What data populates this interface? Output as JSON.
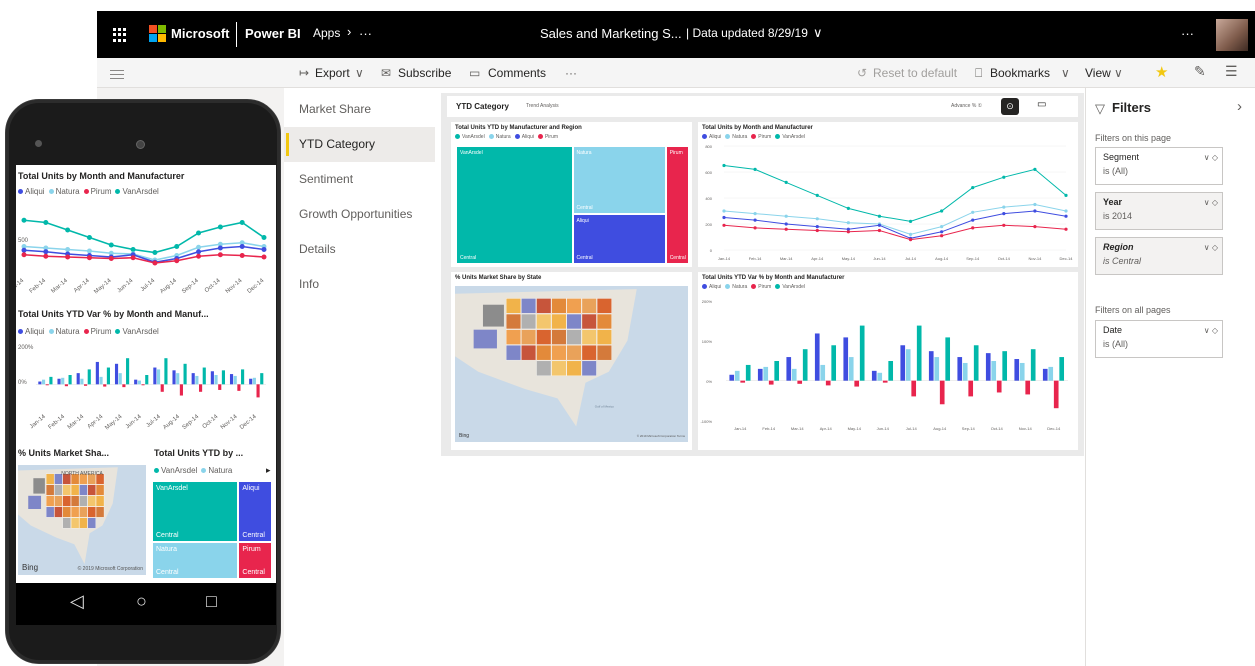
{
  "topbar": {
    "brand": "Microsoft",
    "product": "Power BI",
    "apps": "Apps",
    "more": "···",
    "report": "Sales and Marketing S...",
    "data_updated": "| Data updated 8/29/19",
    "chevron": "∨",
    "ellipsis": "···"
  },
  "commands": {
    "export": "Export",
    "subscribe": "Subscribe",
    "comments": "Comments",
    "more": "···",
    "reset": "Reset to default",
    "bookmarks": "Bookmarks",
    "view": "View"
  },
  "pages": [
    {
      "label": "Market Share",
      "active": false
    },
    {
      "label": "YTD Category",
      "active": true
    },
    {
      "label": "Sentiment",
      "active": false
    },
    {
      "label": "Growth Opportunities",
      "active": false
    },
    {
      "label": "Details",
      "active": false
    },
    {
      "label": "Info",
      "active": false
    }
  ],
  "canvas": {
    "title": "YTD Category",
    "subtitle": "Trend Analysis",
    "toggle": "Advance % ①"
  },
  "months": [
    "Jan-14",
    "Feb-14",
    "Mar-14",
    "Apr-14",
    "May-14",
    "Jun-14",
    "Jul-14",
    "Aug-14",
    "Sep-14",
    "Oct-14",
    "Nov-14",
    "Dec-14"
  ],
  "colors": {
    "VanArsdel": "#01b8aa",
    "Natura": "#8ad4eb",
    "Aliqui": "#3f4de0",
    "Pirum": "#e8254d",
    "accent": "#f2c811"
  },
  "treemap": {
    "title": "Total Units YTD by Manufacturer and Region",
    "legend": [
      "VanArsdel",
      "Natura",
      "Aliqui",
      "Pirum"
    ],
    "cells": [
      {
        "name": "VanArsdel",
        "sub": "Central",
        "color": "#01b8aa"
      },
      {
        "name": "Natura",
        "sub": "Central",
        "color": "#8ad4eb"
      },
      {
        "name": "Aliqui",
        "sub": "Central",
        "color": "#3f4de0"
      },
      {
        "name": "Pirum",
        "sub": "Central",
        "color": "#e8254d"
      }
    ]
  },
  "line_desktop": {
    "title": "Total Units by Month and Manufacturer",
    "legend": [
      "Aliqui",
      "Natura",
      "Pirum",
      "VanArsdel"
    ],
    "ymax": 800,
    "yticks": [
      "800",
      "600",
      "400",
      "200",
      "0"
    ]
  },
  "map": {
    "title": "% Units Market Share by State",
    "bing": "Bing",
    "credit": "© 2019 Microsoft Corporation Terms",
    "gulf": "Gulf of Mexico"
  },
  "bar_desktop": {
    "title": "Total Units YTD Var % by Month and Manufacturer",
    "legend": [
      "Aliqui",
      "Natura",
      "Pirum",
      "VanArsdel"
    ],
    "yticks": [
      "200%",
      "100%",
      "0%",
      "-100%"
    ]
  },
  "chart_data": [
    {
      "type": "line",
      "title": "Total Units by Month and Manufacturer",
      "categories": [
        "Jan-14",
        "Feb-14",
        "Mar-14",
        "Apr-14",
        "May-14",
        "Jun-14",
        "Jul-14",
        "Aug-14",
        "Sep-14",
        "Oct-14",
        "Nov-14",
        "Dec-14"
      ],
      "series": [
        {
          "name": "VanArsdel",
          "values": [
            650,
            620,
            520,
            420,
            320,
            260,
            220,
            300,
            480,
            560,
            620,
            420
          ]
        },
        {
          "name": "Natura",
          "values": [
            300,
            280,
            260,
            240,
            210,
            200,
            120,
            180,
            290,
            330,
            350,
            300
          ]
        },
        {
          "name": "Aliqui",
          "values": [
            250,
            230,
            200,
            180,
            160,
            190,
            90,
            140,
            230,
            280,
            300,
            260
          ]
        },
        {
          "name": "Pirum",
          "values": [
            190,
            170,
            160,
            150,
            140,
            150,
            80,
            110,
            170,
            190,
            180,
            160
          ]
        }
      ],
      "ylim": [
        0,
        800
      ]
    },
    {
      "type": "bar",
      "title": "Total Units YTD Var % by Month and Manufacturer",
      "categories": [
        "Jan-14",
        "Feb-14",
        "Mar-14",
        "Apr-14",
        "May-14",
        "Jun-14",
        "Jul-14",
        "Aug-14",
        "Sep-14",
        "Oct-14",
        "Nov-14",
        "Dec-14"
      ],
      "series": [
        {
          "name": "Aliqui",
          "values": [
            15,
            30,
            60,
            120,
            110,
            25,
            90,
            75,
            60,
            70,
            55,
            30
          ]
        },
        {
          "name": "Natura",
          "values": [
            25,
            35,
            30,
            40,
            60,
            20,
            80,
            60,
            45,
            50,
            45,
            35
          ]
        },
        {
          "name": "Pirum",
          "values": [
            -5,
            -10,
            -8,
            -12,
            -15,
            -5,
            -40,
            -60,
            -40,
            -30,
            -35,
            -70
          ]
        },
        {
          "name": "VanArsdel",
          "values": [
            40,
            50,
            80,
            90,
            140,
            50,
            140,
            110,
            90,
            75,
            80,
            60
          ]
        }
      ],
      "ylim": [
        -100,
        200
      ]
    }
  ],
  "filters": {
    "title": "Filters",
    "on_this_page": "Filters on this page",
    "on_all_pages": "Filters on all pages",
    "cards": [
      {
        "name": "Segment",
        "value": "is (All)"
      },
      {
        "name": "Year",
        "value": "is 2014"
      },
      {
        "name": "Region",
        "value": "is Central"
      },
      {
        "name": "Date",
        "value": "is (All)"
      }
    ]
  },
  "phone": {
    "line_title": "Total Units by Month and Manufacturer",
    "line_legend": [
      "Aliqui",
      "Natura",
      "Pirum",
      "VanArsdel"
    ],
    "line_y": "500",
    "bar_title": "Total Units YTD Var % by Month and Manuf...",
    "bar_y1": "200%",
    "bar_y2": "0%",
    "map_title": "% Units Market Sha...",
    "map_label": "NORTH AMERICA",
    "treemap_title": "Total Units YTD by ...",
    "treemap_legend": [
      "VanArsdel",
      "Natura"
    ],
    "more": "▸",
    "bing": "Bing",
    "credit": "© 2019 Microsoft Corporation"
  }
}
